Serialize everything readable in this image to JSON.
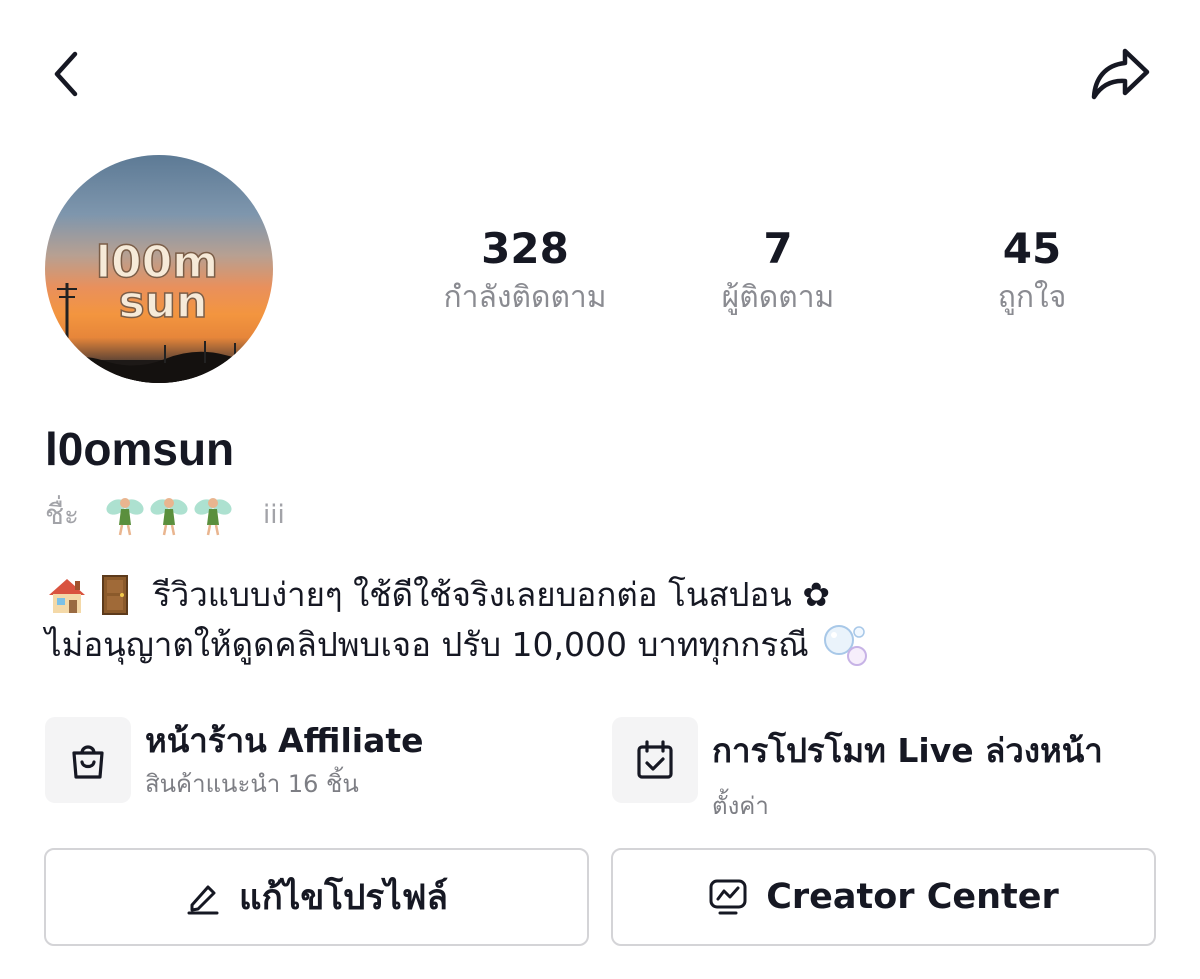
{
  "header": {
    "back_icon": "chevron-left-icon",
    "share_icon": "share-arrow-icon"
  },
  "profile": {
    "avatar_text": "l00m sun",
    "username": "l0omsun",
    "nickname_label": "ชื่ะ",
    "nickname_emoji": [
      "🧚",
      "🧚",
      "🧚"
    ],
    "nickname_suffix": "iii"
  },
  "stats": [
    {
      "value": "328",
      "label": "กำลังติดตาม"
    },
    {
      "value": "7",
      "label": "ผู้ติดตาม"
    },
    {
      "value": "45",
      "label": "ถูกใจ"
    }
  ],
  "bio": {
    "line1_emoji": [
      "🏠",
      "🚪"
    ],
    "line1_text": "รีวิวแบบง่ายๆ ใช้ดีใช้จริงเลยบอกต่อ โนสปอน ✿",
    "line2_text": "ไม่อนุญาตให้ดูดคลิปพบเจอ ปรับ 10,000 บาททุกกรณี",
    "line2_emoji": "🫧"
  },
  "features": [
    {
      "title": "หน้าร้าน Affiliate",
      "subtitle": "สินค้าแนะนำ 16 ชิ้น",
      "icon": "shopping-bag-icon"
    },
    {
      "title": "การโปรโมท Live ล่วงหน้า",
      "subtitle": "ตั้งค่า",
      "icon": "calendar-check-icon"
    }
  ],
  "actions": [
    {
      "label": "แก้ไขโปรไฟล์",
      "icon": "pencil-icon"
    },
    {
      "label": "Creator Center",
      "icon": "chart-monitor-icon"
    }
  ],
  "colors": {
    "text_primary": "#161823",
    "text_secondary": "#8a8b91",
    "border": "#d4d4d7",
    "tile_bg": "#f4f4f5"
  }
}
